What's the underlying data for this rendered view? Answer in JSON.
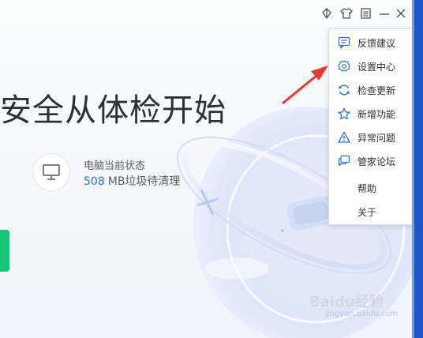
{
  "titlebar": {
    "icons": [
      "skin-leaf-icon",
      "shirt-icon",
      "menu-icon",
      "minimize-icon",
      "close-icon"
    ]
  },
  "hero": {
    "title": "安全从体检开始"
  },
  "status": {
    "label": "电脑当前状态",
    "junk_value": "508",
    "junk_text": "MB垃圾待清理"
  },
  "menu": {
    "items": [
      {
        "label": "反馈建议",
        "icon": "feedback-icon"
      },
      {
        "label": "设置中心",
        "icon": "settings-gear-icon"
      },
      {
        "label": "检查更新",
        "icon": "refresh-icon"
      },
      {
        "label": "新增功能",
        "icon": "star-icon"
      },
      {
        "label": "异常问题",
        "icon": "warning-icon"
      },
      {
        "label": "管家论坛",
        "icon": "forum-icon"
      },
      {
        "label": "帮助",
        "icon": ""
      },
      {
        "label": "关于",
        "icon": ""
      }
    ]
  },
  "colors": {
    "accent_blue": "#2e71d9",
    "annotation_red": "#e53b2f",
    "green": "#16c775",
    "title_text": "#2d3036"
  },
  "watermark": {
    "text": "Baidu经验",
    "sub": "jingyan.baidu.com"
  }
}
